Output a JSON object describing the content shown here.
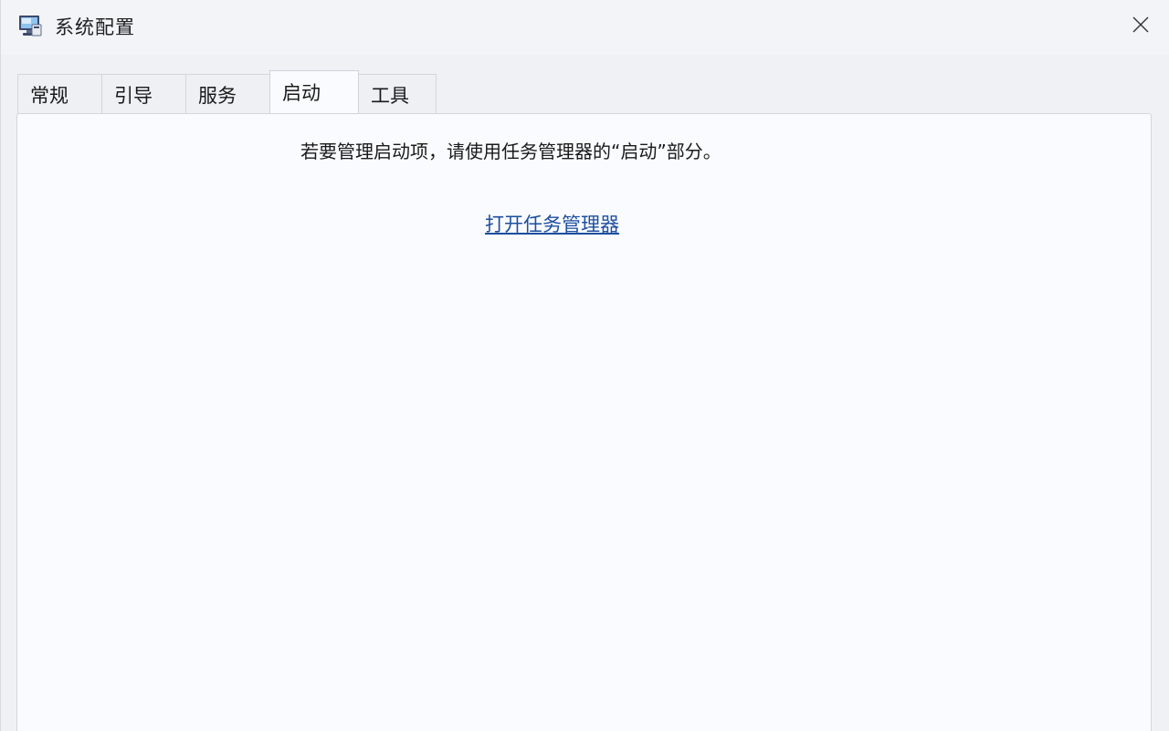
{
  "window": {
    "title": "系统配置"
  },
  "tabs": [
    {
      "label": "常规",
      "active": false
    },
    {
      "label": "引导",
      "active": false
    },
    {
      "label": "服务",
      "active": false
    },
    {
      "label": "启动",
      "active": true
    },
    {
      "label": "工具",
      "active": false
    }
  ],
  "startup": {
    "message": "若要管理启动项，请使用任务管理器的“启动”部分。",
    "link_label": "打开任务管理器"
  },
  "colors": {
    "link": "#1c4f9e",
    "panel_bg": "#fafbfe",
    "window_bg": "#f0f1f5"
  },
  "icons": {
    "app": "system-config-icon",
    "close": "close-icon"
  }
}
